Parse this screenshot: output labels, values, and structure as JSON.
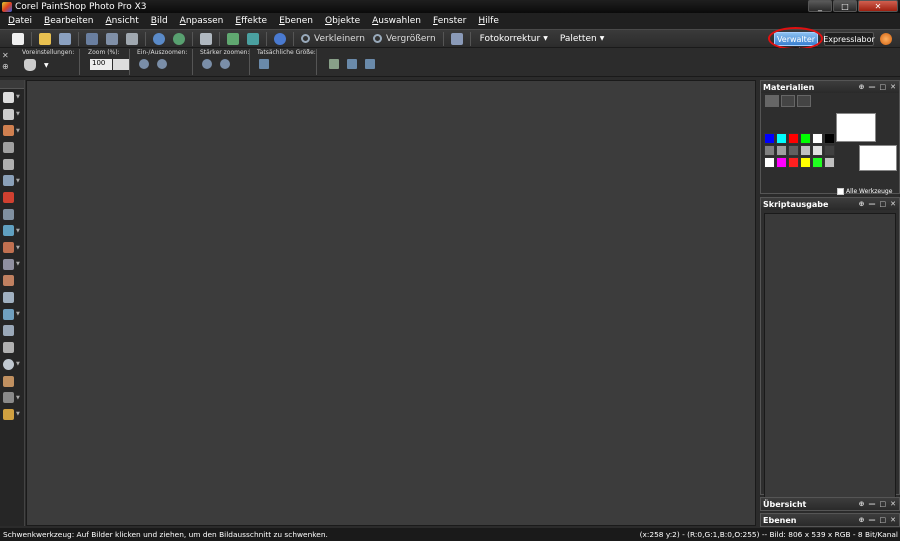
{
  "window": {
    "title": "Corel PaintShop Photo Pro X3",
    "controls": [
      "_",
      "□",
      "✕"
    ]
  },
  "menu": [
    "Datei",
    "Bearbeiten",
    "Ansicht",
    "Bild",
    "Anpassen",
    "Effekte",
    "Ebenen",
    "Objekte",
    "Auswahlen",
    "Fenster",
    "Hilfe"
  ],
  "toolbar": {
    "zoom_out": "Verkleinern",
    "zoom_in": "Vergrößern",
    "fotokorrektur": "Fotokorrektur",
    "paletten": "Paletten",
    "tabs": {
      "verwalter": "Verwalter",
      "expresslabor": "Expresslabor"
    }
  },
  "tool_options": {
    "voreinstellungen": "Voreinstellungen:",
    "zoom": "Zoom (%):",
    "zoom_value": "100",
    "ein_aus": "Ein-/Auszoomen:",
    "staerker": "Stärker zoomen:",
    "tatsaechlich": "Tatsächliche Größe:"
  },
  "panels": {
    "materialien": {
      "title": "Materialien",
      "alle_werkzeuge": "Alle Werkzeuge"
    },
    "skriptausgabe": {
      "title": "Skriptausgabe"
    },
    "uebersicht": {
      "title": "Übersicht"
    },
    "ebenen": {
      "title": "Ebenen"
    },
    "controls": [
      "⊕",
      "—",
      "□",
      "✕"
    ]
  },
  "status": {
    "message": "Schwenkwerkzeug: Auf Bilder klicken und ziehen, um den Bildausschnitt zu schwenken.",
    "info": "(x:258 y:2) - (R:0,G:1,B:0,O:255) -- Bild: 806 x 539 x RGB - 8 Bit/Kanal"
  },
  "colors": {
    "palette": [
      "#0000ff",
      "#00ffff",
      "#ff0000",
      "#00ff00",
      "#ffffff",
      "#000000",
      "#808080",
      "#a0a0a0",
      "#606060",
      "#c0c0c0",
      "#e0e0e0",
      "#404040",
      "#ffffff",
      "#ff00ff",
      "#ff2020",
      "#ffff00",
      "#20ff20",
      "#c0c0c0"
    ],
    "highlight": "#e01010",
    "active_tab": "#3a80d0"
  }
}
